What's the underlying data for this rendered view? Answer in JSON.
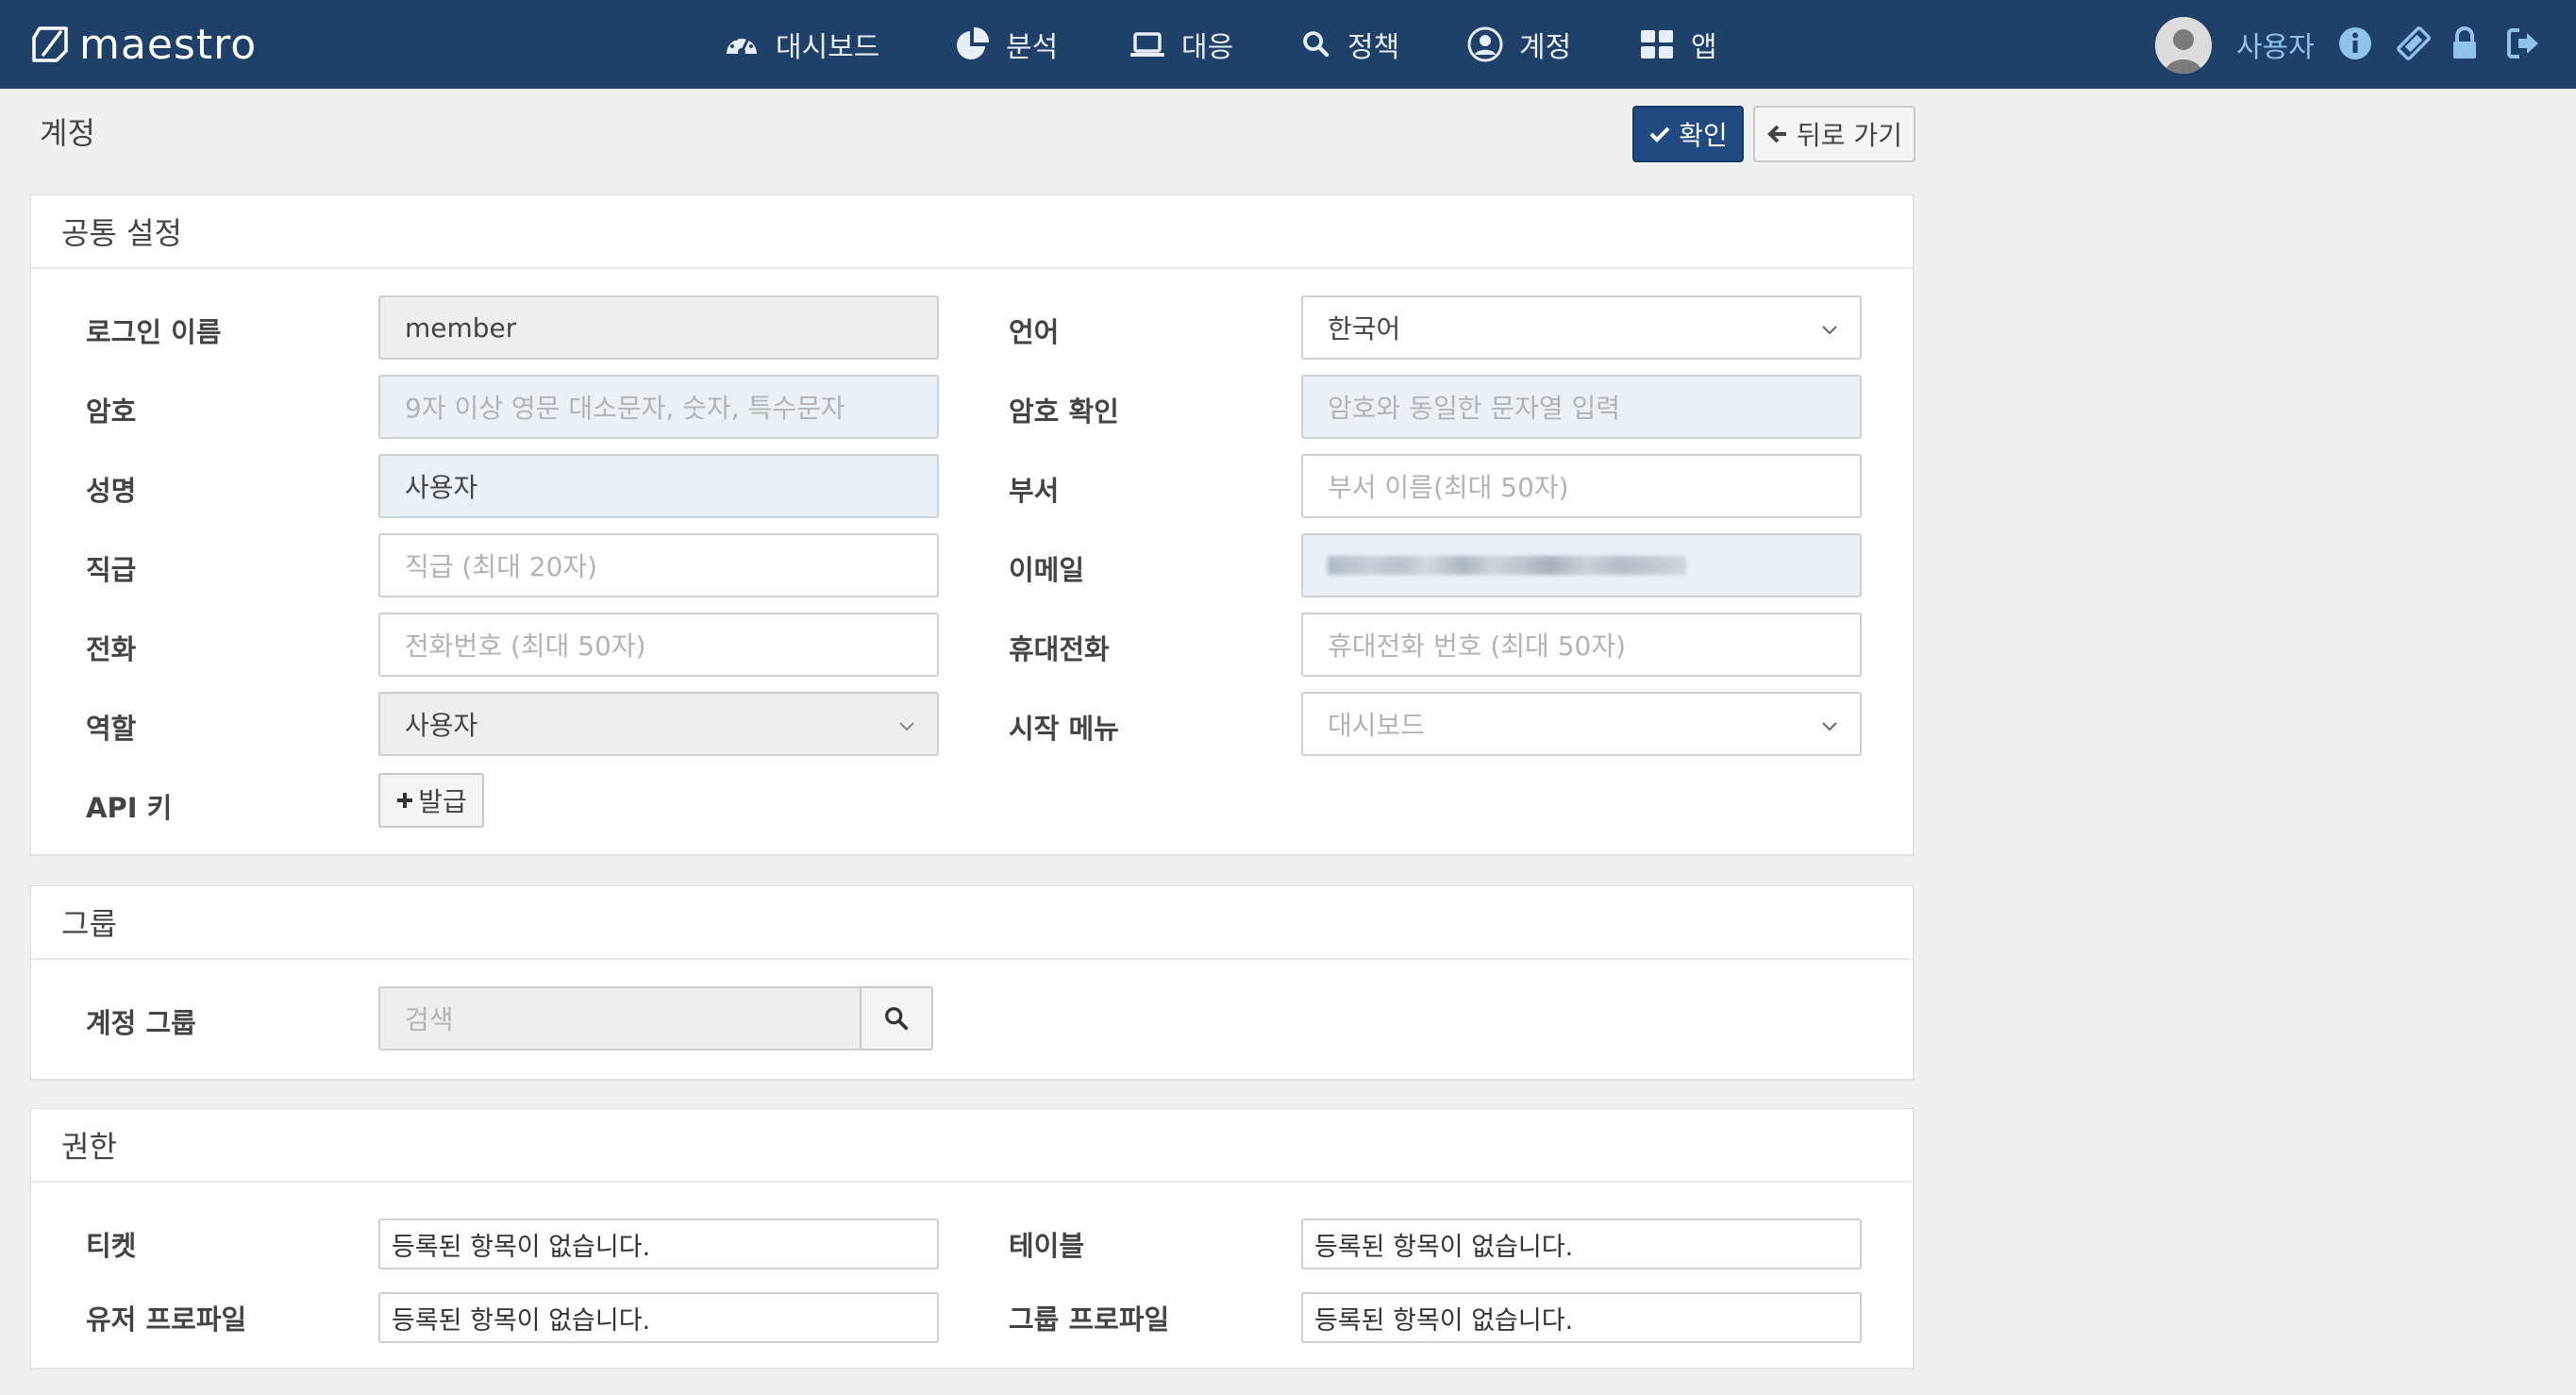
{
  "app": {
    "brand": "maestro"
  },
  "nav": {
    "items": [
      {
        "label": "대시보드",
        "icon": "dashboard-icon"
      },
      {
        "label": "분석",
        "icon": "pie-chart-icon"
      },
      {
        "label": "대응",
        "icon": "laptop-icon"
      },
      {
        "label": "정책",
        "icon": "search-icon"
      },
      {
        "label": "계정",
        "icon": "user-circle-icon"
      },
      {
        "label": "앱",
        "icon": "apps-grid-icon"
      }
    ],
    "user": {
      "name": "사용자"
    },
    "right_icons": [
      "info-icon",
      "ticket-icon",
      "lock-icon",
      "logout-icon"
    ]
  },
  "page": {
    "title": "계정",
    "confirm_label": "확인",
    "back_label": "뒤로 가기"
  },
  "common": {
    "heading": "공통 설정",
    "login_name": {
      "label": "로그인 이름",
      "value": "member"
    },
    "language": {
      "label": "언어",
      "value": "한국어"
    },
    "password": {
      "label": "암호",
      "placeholder": "9자 이상 영문 대소문자, 숫자, 특수문자"
    },
    "password_confirm": {
      "label": "암호 확인",
      "placeholder": "암호와 동일한 문자열 입력"
    },
    "full_name": {
      "label": "성명",
      "value": "사용자"
    },
    "department": {
      "label": "부서",
      "placeholder": "부서 이름(최대 50자)"
    },
    "position": {
      "label": "직급",
      "placeholder": "직급 (최대 20자)"
    },
    "email": {
      "label": "이메일"
    },
    "phone": {
      "label": "전화",
      "placeholder": "전화번호 (최대 50자)"
    },
    "mobile": {
      "label": "휴대전화",
      "placeholder": "휴대전화 번호 (최대 50자)"
    },
    "role": {
      "label": "역할",
      "value": "사용자"
    },
    "start_menu": {
      "label": "시작 메뉴",
      "value": "대시보드"
    },
    "api_key": {
      "label": "API 키",
      "button": "발급"
    }
  },
  "group": {
    "heading": "그룹",
    "account_group": {
      "label": "계정 그룹",
      "placeholder": "검색"
    }
  },
  "permission": {
    "heading": "권한",
    "ticket": {
      "label": "티켓",
      "value": "등록된 항목이 없습니다."
    },
    "table": {
      "label": "테이블",
      "value": "등록된 항목이 없습니다."
    },
    "user_profile": {
      "label": "유저 프로파일",
      "value": "등록된 항목이 없습니다."
    },
    "group_profile": {
      "label": "그룹 프로파일",
      "value": "등록된 항목이 없습니다."
    }
  },
  "colors": {
    "navbar": "#1f4068",
    "primary_button": "#1f4a82",
    "user_link": "#8fc3ec",
    "highlight_input": "#e9f1f7"
  }
}
